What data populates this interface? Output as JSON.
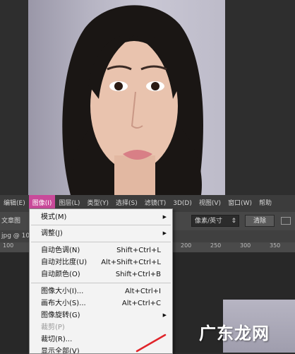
{
  "menubar": {
    "items": [
      {
        "label": "编辑(E)"
      },
      {
        "label": "图像(I)",
        "active": true
      },
      {
        "label": "图层(L)"
      },
      {
        "label": "类型(Y)"
      },
      {
        "label": "选择(S)"
      },
      {
        "label": "滤镜(T)"
      },
      {
        "label": "3D(D)"
      },
      {
        "label": "视图(V)"
      },
      {
        "label": "窗口(W)"
      },
      {
        "label": "帮助"
      }
    ]
  },
  "options_bar": {
    "file_label": "文章图",
    "unit_select": "像素/英寸",
    "clear_button": "清除"
  },
  "doc_tab": {
    "label": "jpg @ 100"
  },
  "ruler": {
    "ticks": [
      "100",
      "50",
      "0",
      "50",
      "100",
      "150",
      "200",
      "250",
      "300",
      "350"
    ]
  },
  "image_menu": {
    "items": [
      {
        "label": "模式(M)",
        "shortcut": "",
        "submenu": true
      },
      {
        "label": "调整(J)",
        "shortcut": "",
        "submenu": true
      },
      {
        "label": "自动色调(N)",
        "shortcut": "Shift+Ctrl+L"
      },
      {
        "label": "自动对比度(U)",
        "shortcut": "Alt+Shift+Ctrl+L"
      },
      {
        "label": "自动颜色(O)",
        "shortcut": "Shift+Ctrl+B"
      },
      {
        "label": "图像大小(I)...",
        "shortcut": "Alt+Ctrl+I"
      },
      {
        "label": "画布大小(S)...",
        "shortcut": "Alt+Ctrl+C"
      },
      {
        "label": "图像旋转(G)",
        "shortcut": "",
        "submenu": true
      },
      {
        "label": "裁剪(P)",
        "shortcut": "",
        "disabled": true
      },
      {
        "label": "裁切(R)...",
        "shortcut": ""
      },
      {
        "label": "显示全部(V)",
        "shortcut": ""
      }
    ],
    "submenu_arrow": "▶"
  },
  "watermark": "广东龙网",
  "colors": {
    "active_menu": "#c94a9a",
    "menu_bg": "#f3f3f3",
    "annotation_line": "#e0242a"
  }
}
